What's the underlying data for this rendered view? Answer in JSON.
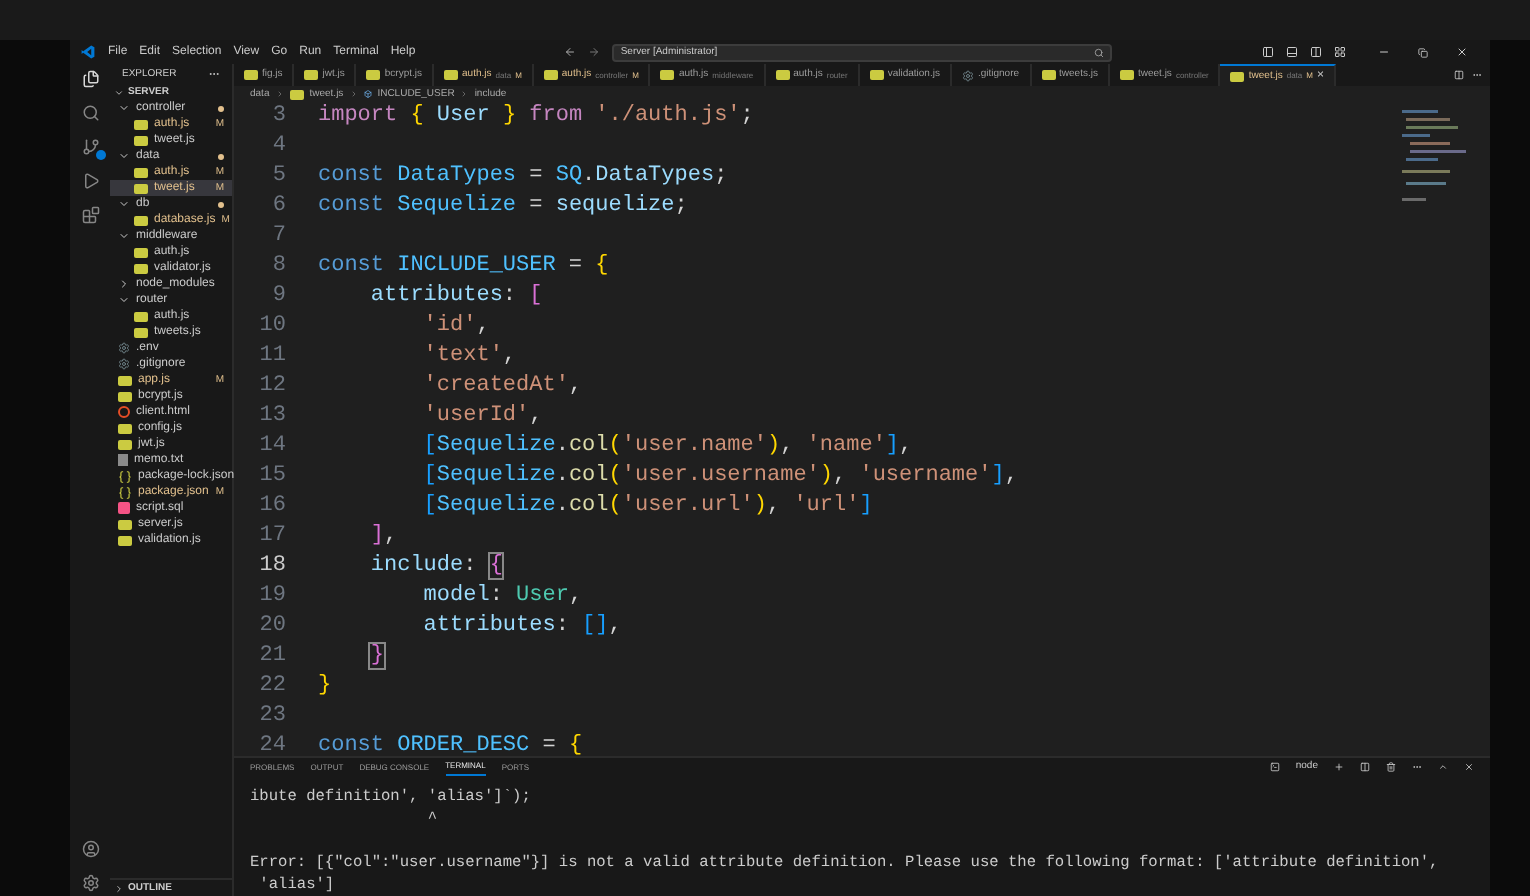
{
  "menu": [
    "File",
    "Edit",
    "Selection",
    "View",
    "Go",
    "Run",
    "Terminal",
    "Help"
  ],
  "command_center": {
    "value": "Server [Administrator]"
  },
  "sidebar": {
    "title": "EXPLORER",
    "root": "SERVER",
    "items": [
      {
        "label": "controller",
        "kind": "folder",
        "expanded": true,
        "dot": true,
        "children": [
          {
            "label": "auth.js",
            "kind": "js",
            "status": "M",
            "selected": false
          },
          {
            "label": "tweet.js",
            "kind": "js",
            "selected": false
          }
        ]
      },
      {
        "label": "data",
        "kind": "folder",
        "expanded": true,
        "dot": true,
        "children": [
          {
            "label": "auth.js",
            "kind": "js",
            "status": "M",
            "selected": false
          },
          {
            "label": "tweet.js",
            "kind": "js",
            "status": "M",
            "selected": true
          }
        ]
      },
      {
        "label": "db",
        "kind": "folder",
        "expanded": true,
        "dot": true,
        "children": [
          {
            "label": "database.js",
            "kind": "js",
            "status": "M",
            "selected": false
          }
        ]
      },
      {
        "label": "middleware",
        "kind": "folder",
        "expanded": true,
        "dot": false,
        "children": [
          {
            "label": "auth.js",
            "kind": "js",
            "selected": false
          },
          {
            "label": "validator.js",
            "kind": "js",
            "selected": false
          }
        ]
      },
      {
        "label": "node_modules",
        "kind": "folder",
        "expanded": false,
        "dot": false
      },
      {
        "label": "router",
        "kind": "folder",
        "expanded": true,
        "dot": false,
        "children": [
          {
            "label": "auth.js",
            "kind": "js",
            "selected": false
          },
          {
            "label": "tweets.js",
            "kind": "js",
            "selected": false
          }
        ]
      },
      {
        "label": ".env",
        "kind": "gear",
        "selected": false
      },
      {
        "label": ".gitignore",
        "kind": "gear",
        "selected": false
      },
      {
        "label": "app.js",
        "kind": "js",
        "status": "M",
        "selected": false
      },
      {
        "label": "bcrypt.js",
        "kind": "js",
        "selected": false
      },
      {
        "label": "client.html",
        "kind": "html",
        "selected": false
      },
      {
        "label": "config.js",
        "kind": "js",
        "selected": false
      },
      {
        "label": "jwt.js",
        "kind": "js",
        "selected": false
      },
      {
        "label": "memo.txt",
        "kind": "txt",
        "selected": false
      },
      {
        "label": "package-lock.json",
        "kind": "json",
        "selected": false
      },
      {
        "label": "package.json",
        "kind": "json",
        "status": "M",
        "selected": false
      },
      {
        "label": "script.sql",
        "kind": "sql",
        "selected": false
      },
      {
        "label": "server.js",
        "kind": "js",
        "selected": false
      },
      {
        "label": "validation.js",
        "kind": "js",
        "selected": false
      }
    ],
    "outline": "OUTLINE"
  },
  "tabs": [
    {
      "label": "fig.js",
      "kind": "js",
      "selected": false
    },
    {
      "label": "jwt.js",
      "kind": "js",
      "selected": false
    },
    {
      "label": "bcrypt.js",
      "kind": "js",
      "selected": false
    },
    {
      "label": "auth.js",
      "hint": "data",
      "status": "M",
      "kind": "js",
      "selected": false
    },
    {
      "label": "auth.js",
      "hint": "controller",
      "status": "M",
      "kind": "js",
      "selected": false
    },
    {
      "label": "auth.js",
      "hint": "middleware",
      "kind": "js",
      "selected": false
    },
    {
      "label": "auth.js",
      "hint": "router",
      "kind": "js",
      "selected": false
    },
    {
      "label": "validation.js",
      "kind": "js",
      "selected": false
    },
    {
      "label": ".gitignore",
      "kind": "gear",
      "selected": false
    },
    {
      "label": "tweets.js",
      "kind": "js",
      "selected": false
    },
    {
      "label": "tweet.js",
      "hint": "controller",
      "kind": "js",
      "selected": false
    },
    {
      "label": "tweet.js",
      "hint": "data",
      "status": "M",
      "kind": "js",
      "selected": true,
      "close": "×"
    }
  ],
  "breadcrumb": [
    "data",
    "tweet.js",
    "INCLUDE_USER",
    "include"
  ],
  "editor": {
    "lines": [
      {
        "number": "3",
        "current": false,
        "tokens": [
          {
            "text": "import ",
            "kind": "keyword2"
          },
          {
            "text": "{ ",
            "kind": "bracket1"
          },
          {
            "text": "User ",
            "kind": "variable"
          },
          {
            "text": "} ",
            "kind": "bracket1"
          },
          {
            "text": "from ",
            "kind": "keyword2"
          },
          {
            "text": "'./auth.js'",
            "kind": "string"
          },
          {
            "text": ";",
            "kind": "punct"
          }
        ]
      },
      {
        "number": "4",
        "current": false
      },
      {
        "number": "5",
        "current": false,
        "tokens": [
          {
            "text": "const ",
            "kind": "keyword"
          },
          {
            "text": "DataTypes",
            "kind": "constant"
          },
          {
            "text": " = ",
            "kind": "punct"
          },
          {
            "text": "SQ",
            "kind": "constant"
          },
          {
            "text": ".",
            "kind": "punct"
          },
          {
            "text": "DataTypes",
            "kind": "variable"
          },
          {
            "text": ";",
            "kind": "punct"
          }
        ]
      },
      {
        "number": "6",
        "current": false,
        "tokens": [
          {
            "text": "const ",
            "kind": "keyword"
          },
          {
            "text": "Sequelize",
            "kind": "constant"
          },
          {
            "text": " = ",
            "kind": "punct"
          },
          {
            "text": "sequelize",
            "kind": "variable"
          },
          {
            "text": ";",
            "kind": "punct"
          }
        ]
      },
      {
        "number": "7",
        "current": false
      },
      {
        "number": "8",
        "current": false,
        "tokens": [
          {
            "text": "const ",
            "kind": "keyword"
          },
          {
            "text": "INCLUDE_USER",
            "kind": "constant"
          },
          {
            "text": " = ",
            "kind": "punct"
          },
          {
            "text": "{",
            "kind": "bracket1"
          }
        ]
      },
      {
        "number": "9",
        "current": false,
        "tokens": [
          {
            "text": "    attributes",
            "kind": "variable"
          },
          {
            "text": ": ",
            "kind": "punct"
          },
          {
            "text": "[",
            "kind": "bracket2"
          }
        ]
      },
      {
        "number": "10",
        "current": false,
        "tokens": [
          {
            "text": "        'id'",
            "kind": "string"
          },
          {
            "text": ",",
            "kind": "punct"
          }
        ]
      },
      {
        "number": "11",
        "current": false,
        "tokens": [
          {
            "text": "        'text'",
            "kind": "string"
          },
          {
            "text": ",",
            "kind": "punct"
          }
        ]
      },
      {
        "number": "12",
        "current": false,
        "tokens": [
          {
            "text": "        'createdAt'",
            "kind": "string"
          },
          {
            "text": ",",
            "kind": "punct"
          }
        ]
      },
      {
        "number": "13",
        "current": false,
        "tokens": [
          {
            "text": "        'userId'",
            "kind": "string"
          },
          {
            "text": ",",
            "kind": "punct"
          }
        ]
      },
      {
        "number": "14",
        "current": false,
        "tokens": [
          {
            "text": "        [",
            "kind": "bracket3"
          },
          {
            "text": "Sequelize",
            "kind": "constant"
          },
          {
            "text": ".",
            "kind": "punct"
          },
          {
            "text": "col",
            "kind": "function"
          },
          {
            "text": "(",
            "kind": "bracket1"
          },
          {
            "text": "'user.name'",
            "kind": "string"
          },
          {
            "text": ")",
            "kind": "bracket1"
          },
          {
            "text": ", ",
            "kind": "punct"
          },
          {
            "text": "'name'",
            "kind": "string"
          },
          {
            "text": "]",
            "kind": "bracket3"
          },
          {
            "text": ",",
            "kind": "punct"
          }
        ]
      },
      {
        "number": "15",
        "current": false,
        "tokens": [
          {
            "text": "        [",
            "kind": "bracket3"
          },
          {
            "text": "Sequelize",
            "kind": "constant"
          },
          {
            "text": ".",
            "kind": "punct"
          },
          {
            "text": "col",
            "kind": "function"
          },
          {
            "text": "(",
            "kind": "bracket1"
          },
          {
            "text": "'user.username'",
            "kind": "string"
          },
          {
            "text": ")",
            "kind": "bracket1"
          },
          {
            "text": ", ",
            "kind": "punct"
          },
          {
            "text": "'username'",
            "kind": "string"
          },
          {
            "text": "]",
            "kind": "bracket3"
          },
          {
            "text": ",",
            "kind": "punct"
          }
        ]
      },
      {
        "number": "16",
        "current": false,
        "tokens": [
          {
            "text": "        [",
            "kind": "bracket3"
          },
          {
            "text": "Sequelize",
            "kind": "constant"
          },
          {
            "text": ".",
            "kind": "punct"
          },
          {
            "text": "col",
            "kind": "function"
          },
          {
            "text": "(",
            "kind": "bracket1"
          },
          {
            "text": "'user.url'",
            "kind": "string"
          },
          {
            "text": ")",
            "kind": "bracket1"
          },
          {
            "text": ", ",
            "kind": "punct"
          },
          {
            "text": "'url'",
            "kind": "string"
          },
          {
            "text": "]",
            "kind": "bracket3"
          }
        ]
      },
      {
        "number": "17",
        "current": false,
        "tokens": [
          {
            "text": "    ]",
            "kind": "bracket2"
          },
          {
            "text": ",",
            "kind": "punct"
          }
        ]
      },
      {
        "number": "18",
        "current": true,
        "tokens": [
          {
            "text": "    include",
            "kind": "variable"
          },
          {
            "text": ": ",
            "kind": "punct"
          },
          {
            "text": "{",
            "kind": "matched"
          }
        ]
      },
      {
        "number": "19",
        "current": false,
        "tokens": [
          {
            "text": "        model",
            "kind": "variable"
          },
          {
            "text": ": ",
            "kind": "punct"
          },
          {
            "text": "User",
            "kind": "type"
          },
          {
            "text": ",",
            "kind": "punct"
          }
        ]
      },
      {
        "number": "20",
        "current": false,
        "tokens": [
          {
            "text": "        attributes",
            "kind": "variable"
          },
          {
            "text": ": ",
            "kind": "punct"
          },
          {
            "text": "[]",
            "kind": "bracket3"
          },
          {
            "text": ",",
            "kind": "punct"
          }
        ]
      },
      {
        "number": "21",
        "current": false,
        "tokens": [
          {
            "text": "    }",
            "kind": "matched"
          }
        ]
      },
      {
        "number": "22",
        "current": false,
        "tokens": [
          {
            "text": "}",
            "kind": "bracket1"
          }
        ]
      },
      {
        "number": "23",
        "current": false
      },
      {
        "number": "24",
        "current": false,
        "tokens": [
          {
            "text": "const ",
            "kind": "keyword"
          },
          {
            "text": "ORDER_DESC",
            "kind": "constant"
          },
          {
            "text": " = ",
            "kind": "punct"
          },
          {
            "text": "{",
            "kind": "bracket1"
          }
        ]
      }
    ]
  },
  "panel": {
    "tabs": [
      {
        "label": "PROBLEMS",
        "selected": false
      },
      {
        "label": "OUTPUT",
        "selected": false
      },
      {
        "label": "DEBUG CONSOLE",
        "selected": false
      },
      {
        "label": "TERMINAL",
        "selected": true
      },
      {
        "label": "PORTS",
        "selected": false
      }
    ],
    "shell": "node",
    "lines": [
      {
        "text": "ibute definition', 'alias']`);",
        "kind": "output"
      },
      {
        "text": "                   ^",
        "kind": "output"
      },
      {
        "text": "Error: [{\"col\":\"user.username\"}] is not a valid attribute definition. Please use the following format: ['attribute definition',",
        "kind": "error"
      },
      {
        "text": " 'alias']",
        "kind": "output"
      }
    ]
  }
}
